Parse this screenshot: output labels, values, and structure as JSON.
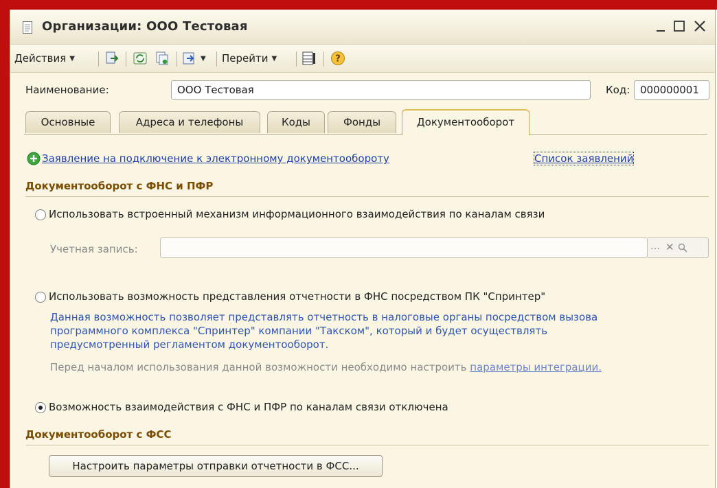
{
  "window": {
    "title": "Организации: ООО Тестовая",
    "controls": {
      "minimize": "_",
      "maximize": "□",
      "close": "✕"
    }
  },
  "toolbar": {
    "actions_label": "Действия",
    "goto_label": "Перейти",
    "help_symbol": "?",
    "icons": [
      "save-close-icon",
      "refresh-icon",
      "copy-icon",
      "insert-icon",
      "structure-icon",
      "help-icon"
    ]
  },
  "form": {
    "name_label": "Наименование:",
    "name_value": "ООО Тестовая",
    "code_label": "Код:",
    "code_value": "000000001"
  },
  "tabs": [
    {
      "label": "Основные"
    },
    {
      "label": "Адреса и телефоны"
    },
    {
      "label": "Коды"
    },
    {
      "label": "Фонды"
    },
    {
      "label": "Документооборот",
      "active": true
    }
  ],
  "docflow": {
    "application_link": "Заявление на подключение к электронному документообороту",
    "applications_list_link": "Список заявлений",
    "fns_section_title": "Документооборот с ФНС и ПФР",
    "option_builtin": "Использовать встроенный механизм информационного взаимодействия по каналам связи",
    "account_label": "Учетная запись:",
    "account_value": "",
    "option_sprinter": "Использовать возможность представления отчетности в ФНС посредством ПК \"Спринтер\"",
    "sprinter_info_line1": "Данная возможность позволяет представлять отчетность в налоговые органы посредством вызова",
    "sprinter_info_line2": "программного комплекса \"Спринтер\" компании \"Такском\", который и будет осуществлять",
    "sprinter_info_line3": "предусмотренный регламентом документооборот.",
    "integration_note": "Перед началом использования данной возможности необходимо настроить",
    "integration_link": "параметры интеграции.",
    "option_disabled": "Возможность взаимодействия с ФНС и ПФР по каналам связи отключена",
    "selected_option": "disabled",
    "fss_section_title": "Документооборот с ФСС",
    "fss_button": "Настроить параметры отправки отчетности в ФСС..."
  },
  "colors": {
    "window_bg": "#fbf6e4",
    "section_title": "#7a4d00",
    "link": "#1f3fa6",
    "info_text": "#2f55b0",
    "accent_red": "#c00e0e",
    "active_tab_top": "#e4bb52"
  }
}
